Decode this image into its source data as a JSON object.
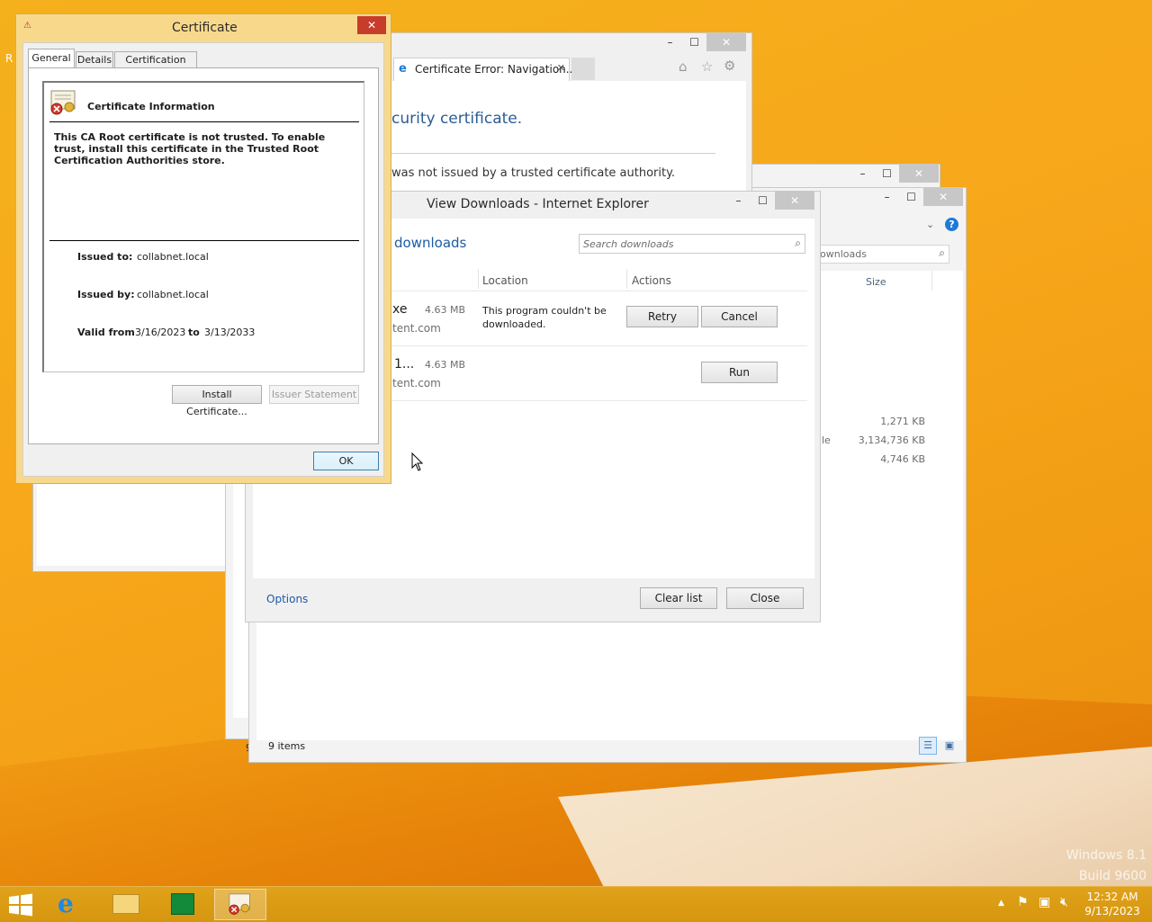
{
  "desktop": {
    "watermark_line1": "Windows 8.1",
    "watermark_line2": "Build 9600",
    "icon_label": "R"
  },
  "ie_window": {
    "tab_title": "Certificate Error: Navigation...",
    "heading": "curity certificate.",
    "message": "was not issued by a trusted certificate authority."
  },
  "explorer_window": {
    "search_placeholder": "ownloads",
    "column_size": "Size",
    "rows": [
      {
        "type": "",
        "size": "1,271 KB"
      },
      {
        "type": "le",
        "size": "3,134,736 KB"
      },
      {
        "type": "",
        "size": "4,746 KB"
      }
    ],
    "status": "9 items",
    "left_fragment": "9"
  },
  "downloads_window": {
    "title": "View Downloads - Internet Explorer",
    "heading": "downloads",
    "search_placeholder": "Search downloads",
    "col_location": "Location",
    "col_actions": "Actions",
    "items": [
      {
        "name": "xe",
        "size": "4.63 MB",
        "source": "tent.com",
        "status": "This program couldn't be downloaded.",
        "btn1": "Retry",
        "btn2": "Cancel"
      },
      {
        "name": "1...",
        "size": "4.63 MB",
        "source": "tent.com",
        "status": "",
        "btn1": "Run"
      }
    ],
    "options": "Options",
    "clear_list": "Clear list",
    "close": "Close"
  },
  "certificate_dialog": {
    "title": "Certificate",
    "tabs": [
      "General",
      "Details",
      "Certification Path"
    ],
    "info_heading": "Certificate Information",
    "warning": "This CA Root certificate is not trusted. To enable trust, install this certificate in the Trusted Root Certification Authorities store.",
    "issued_to_label": "Issued to:",
    "issued_to": "collabnet.local",
    "issued_by_label": "Issued by:",
    "issued_by": "collabnet.local",
    "valid_from_label": "Valid from",
    "valid_from": "3/16/2023",
    "to_label": "to",
    "valid_to": "3/13/2033",
    "install_btn": "Install Certificate...",
    "issuer_btn": "Issuer Statement",
    "ok_btn": "OK"
  },
  "taskbar": {
    "time": "12:32 AM",
    "date": "9/13/2023",
    "tray_arrow": "▲"
  },
  "colors": {
    "accent_link": "#1c5aa6",
    "ie_heading": "#2a5d94",
    "desktop": "#f4a81b"
  }
}
